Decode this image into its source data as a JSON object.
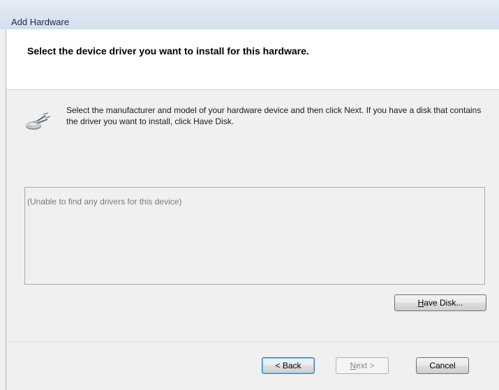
{
  "window": {
    "title": "Add Hardware"
  },
  "header": {
    "title": "Select the device driver you want to install for this hardware."
  },
  "body": {
    "icon": "hardware-cable-icon",
    "instructions": "Select the manufacturer and model of your hardware device and then click Next. If you have a disk that contains the driver you want to install, click Have Disk.",
    "driver_list_message": "(Unable to find any drivers for this device)"
  },
  "buttons": {
    "have_disk_mnemonic": "H",
    "have_disk_rest": "ave Disk...",
    "back_label": "< Back",
    "next_mnemonic": "N",
    "next_rest": "ext >",
    "cancel_label": "Cancel",
    "next_enabled": false
  }
}
